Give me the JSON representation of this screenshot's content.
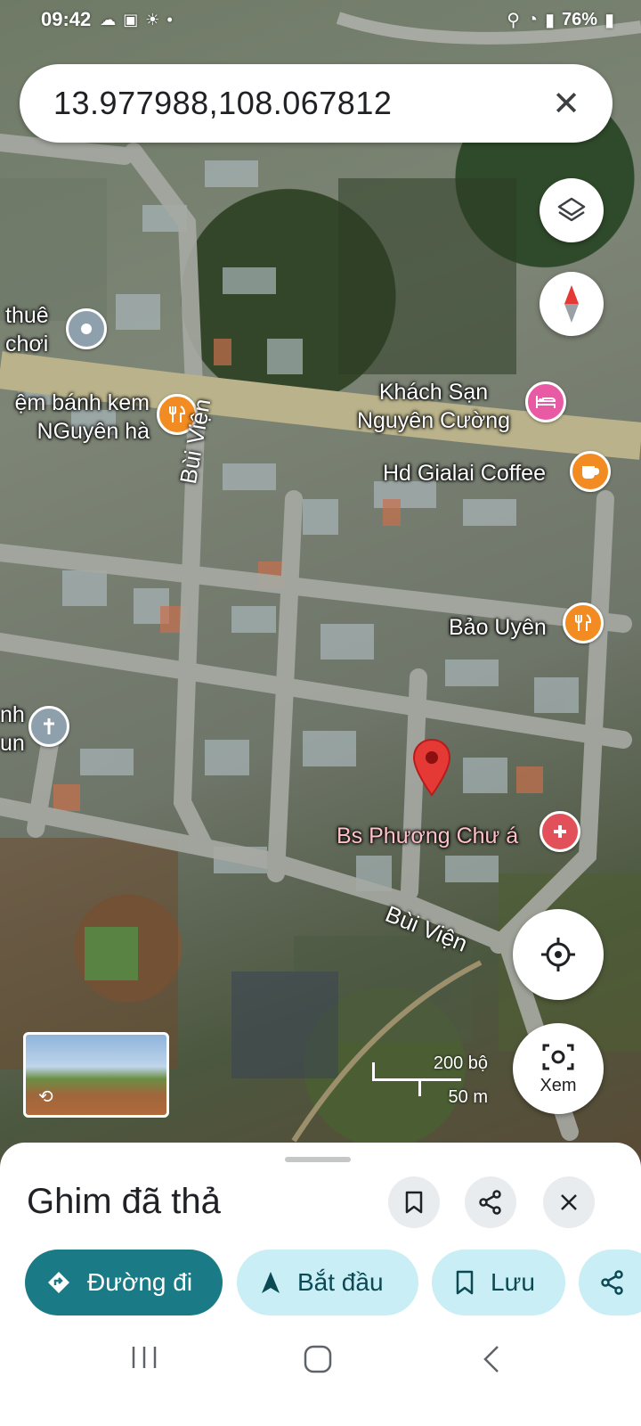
{
  "status_bar": {
    "time": "09:42",
    "battery": "76%"
  },
  "search": {
    "query": "13.977988,108.067812"
  },
  "map_labels": {
    "place_1_line1": "thuê",
    "place_1_line2": "chơi",
    "bakery_line1": "ệm bánh kem",
    "bakery_line2": "NGuyên hà",
    "hotel_line1": "Khách Sạn",
    "hotel_line2": "Nguyên Cường",
    "coffee": "Hd Gialai Coffee",
    "restaurant": "Bảo Uyên",
    "church_line1": "nh",
    "church_line2": "un",
    "clinic": "Bs Phương Chư á",
    "street_1": "Bùi Viện",
    "street_2": "Bùi Viện"
  },
  "scale": {
    "imperial": "200 bộ",
    "metric": "50 m"
  },
  "view_button": {
    "label": "Xem"
  },
  "sheet": {
    "title": "Ghim đã thả",
    "chips": {
      "directions": "Đường đi",
      "start": "Bắt đầu",
      "save": "Lưu"
    }
  },
  "colors": {
    "accent": "#1a7b86",
    "chip_bg": "#c9eef5",
    "pin_red": "#e53935",
    "poi_orange": "#f28b21",
    "poi_magenta": "#e95aa4"
  }
}
